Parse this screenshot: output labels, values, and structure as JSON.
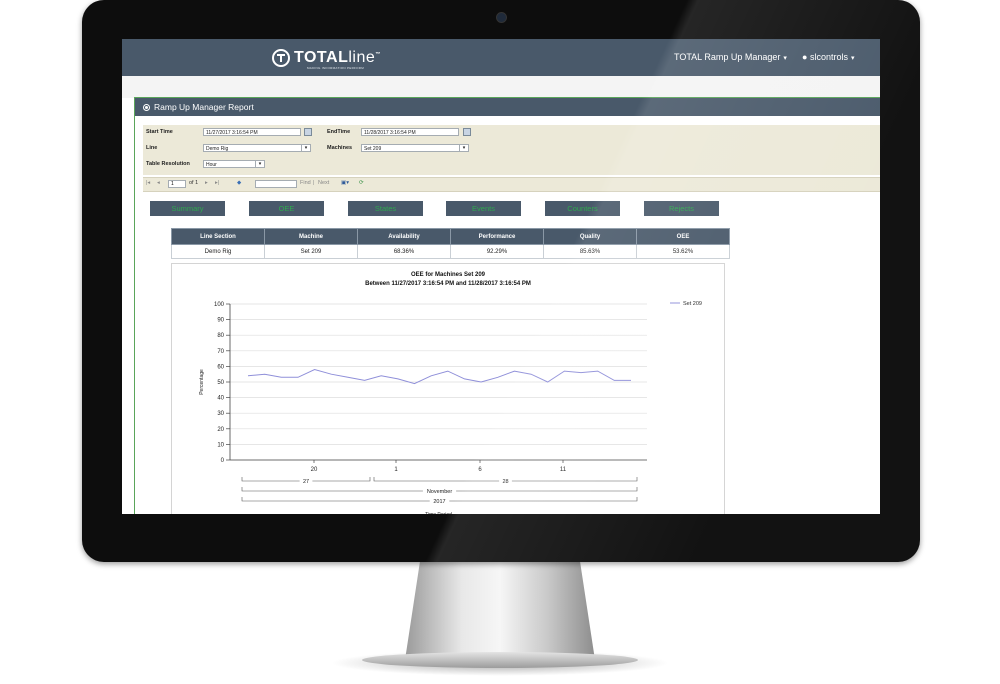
{
  "nav": {
    "logo_bold": "TOTAL",
    "logo_light": "line",
    "logo_tm": "™",
    "logo_tagline": "MAKING INFORMATION PERFORM",
    "manager_menu": "TOTAL Ramp Up Manager",
    "user_menu": "slcontrols"
  },
  "panel": {
    "title": "Ramp Up Manager Report"
  },
  "params": {
    "start_time_label": "Start Time",
    "start_time_value": "11/27/2017 3:16:54 PM",
    "end_time_label": "EndTime",
    "end_time_value": "11/28/2017 3:16:54 PM",
    "line_label": "Line",
    "line_value": "Demo Rig",
    "machines_label": "Machines",
    "machines_value": "Set 209",
    "resolution_label": "Table Resolution",
    "resolution_value": "Hour"
  },
  "toolbar": {
    "page_value": "1",
    "of_label": "of 1",
    "find_label": "Find",
    "separator": "|",
    "next_label": "Next"
  },
  "tabs": [
    "Summary",
    "OEE",
    "States",
    "Events",
    "Counters",
    "Rejects"
  ],
  "table": {
    "headers": [
      "Line Section",
      "Machine",
      "Availability",
      "Performance",
      "Quality",
      "OEE"
    ],
    "rows": [
      [
        "Demo Rig",
        "Set 209",
        "68.36%",
        "92.29%",
        "85.63%",
        "53.62%"
      ]
    ]
  },
  "chart_data": {
    "type": "line",
    "title": "OEE for Machines Set 209",
    "subtitle": "Between 11/27/2017 3:16:54 PM and 11/28/2017 3:16:54 PM",
    "ylabel": "Percentage",
    "xlabel": "Time Period",
    "ylim": [
      0,
      100
    ],
    "yticks": [
      0,
      10,
      20,
      30,
      40,
      50,
      60,
      70,
      80,
      90,
      100
    ],
    "xticks": [
      "20",
      "1",
      "6",
      "11"
    ],
    "group_labels": [
      "27",
      "28"
    ],
    "month_label": "November",
    "year_label": "2017",
    "legend_position": "top-right",
    "series": [
      {
        "name": "Set 209",
        "color": "#8f8fd9",
        "values": [
          54,
          55,
          53,
          53,
          58,
          55,
          53,
          51,
          54,
          52,
          49,
          54,
          57,
          52,
          50,
          53,
          57,
          55,
          50,
          57,
          56,
          57,
          51,
          51
        ]
      }
    ]
  }
}
